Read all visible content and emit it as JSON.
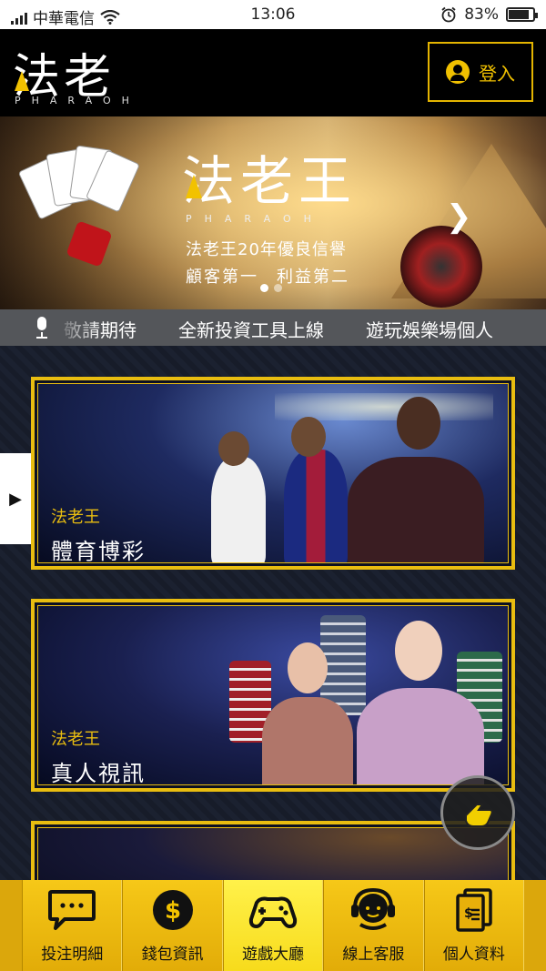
{
  "status_bar": {
    "carrier": "中華電信",
    "time": "13:06",
    "battery": "83%",
    "battery_level": 0.83
  },
  "header": {
    "logo_text": "法老王",
    "logo_sub": "PHARAOH",
    "login_label": "登入"
  },
  "banner": {
    "logo_text": "法老王",
    "logo_sub": "PHARAOH",
    "line1": "法老王20年優良信譽",
    "line2": "顧客第一　利益第二",
    "slide_count": 2,
    "active_slide": 1
  },
  "ticker": {
    "items": [
      "敬請期待",
      "全新投資工具上線",
      "遊玩娛樂場個人"
    ]
  },
  "games": [
    {
      "brand": "法老王",
      "title": "體育博彩"
    },
    {
      "brand": "法老王",
      "title": "真人視訊"
    }
  ],
  "bottom_nav": [
    {
      "label": "投注明細",
      "icon": "chat-bubble-icon"
    },
    {
      "label": "錢包資訊",
      "icon": "dollar-coin-icon"
    },
    {
      "label": "遊戲大廳",
      "icon": "gamepad-icon",
      "active": true
    },
    {
      "label": "線上客服",
      "icon": "headset-agent-icon"
    },
    {
      "label": "個人資料",
      "icon": "document-icon"
    }
  ],
  "colors": {
    "accent": "#e9bd10",
    "nav_bg": "#dba70c",
    "nav_active": "#fff14a"
  }
}
